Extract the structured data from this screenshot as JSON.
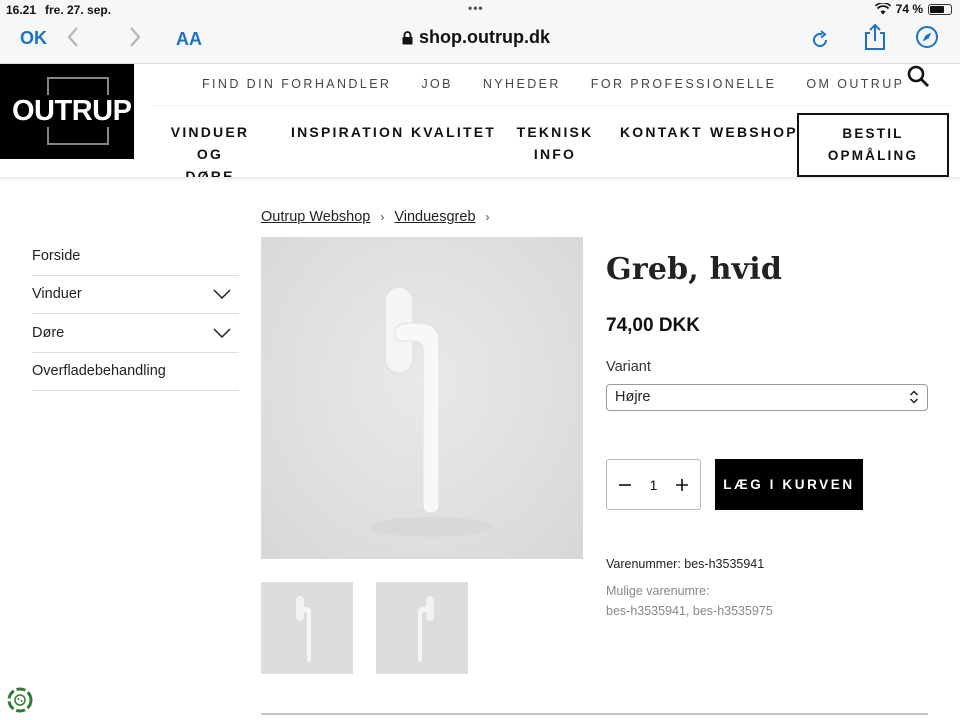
{
  "status_bar": {
    "time": "16.21",
    "date": "fre. 27. sep.",
    "battery_text": "74 %",
    "battery_level": 0.74
  },
  "browser": {
    "done_label": "OK",
    "text_size_label": "AA",
    "url": "shop.outrup.dk"
  },
  "header": {
    "logo_text": "OUTRUP",
    "top_nav": [
      "FIND DIN FORHANDLER",
      "JOB",
      "NYHEDER",
      "FOR PROFESSIONELLE",
      "OM OUTRUP"
    ],
    "main_nav": [
      {
        "line1": "VINDUER OG",
        "line2": "DØRE"
      },
      {
        "line1": "INSPIRATION",
        "line2": ""
      },
      {
        "line1": "KVALITET",
        "line2": ""
      },
      {
        "line1": "TEKNISK",
        "line2": "INFO"
      },
      {
        "line1": "KONTAKT",
        "line2": ""
      },
      {
        "line1": "WEBSHOP",
        "line2": ""
      }
    ],
    "cta": {
      "line1": "BESTIL",
      "line2": "OPMÅLING"
    }
  },
  "breadcrumb": [
    "Outrup Webshop",
    "Vinduesgreb"
  ],
  "sidebar": [
    "Forside",
    "Vinduer",
    "Døre",
    "Overfladebehandling"
  ],
  "product": {
    "title": "Greb, hvid",
    "price": "74,00 DKK",
    "variant_label": "Variant",
    "variant_value": "Højre",
    "quantity": "1",
    "add_to_cart": "LÆG I KURVEN",
    "sku": "Varenummer: bes-h3535941",
    "alt_label": "Mulige varenumre:",
    "alt_skus": "bes-h3535941, bes-h3535975"
  }
}
